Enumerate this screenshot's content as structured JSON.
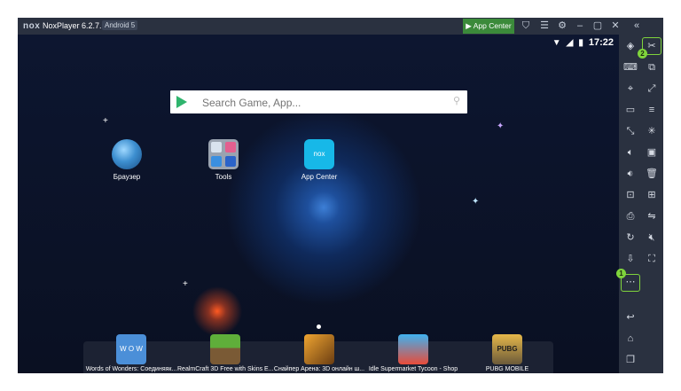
{
  "titlebar": {
    "logo": "nox",
    "title": "NoxPlayer 6.2.7.1",
    "android": "Android 5",
    "app_center": "App Center"
  },
  "status": {
    "time": "17:22"
  },
  "search": {
    "placeholder": "Search Game, App..."
  },
  "desktop": {
    "icons": [
      {
        "label": "Браузер"
      },
      {
        "label": "Tools"
      },
      {
        "label": "App Center",
        "icon_text": "nox"
      }
    ]
  },
  "dock": {
    "apps": [
      {
        "label": "Words of Wonders: Соединяяк...",
        "icon_text": "W O W"
      },
      {
        "label": "RealmCraft 3D Free with Skins E..."
      },
      {
        "label": "Снайпер Арена: 3D онлайн ш..."
      },
      {
        "label": "Idle Supermarket Tycoon - Shop"
      },
      {
        "label": "PUBG MOBILE",
        "icon_text": "PUBG"
      }
    ]
  },
  "annotations": {
    "badge1": "1",
    "badge2": "2"
  },
  "colors": {
    "accent_green": "#7fd43c",
    "appcenter_green": "#3b8a3a",
    "sidebar": "#2a3140"
  }
}
